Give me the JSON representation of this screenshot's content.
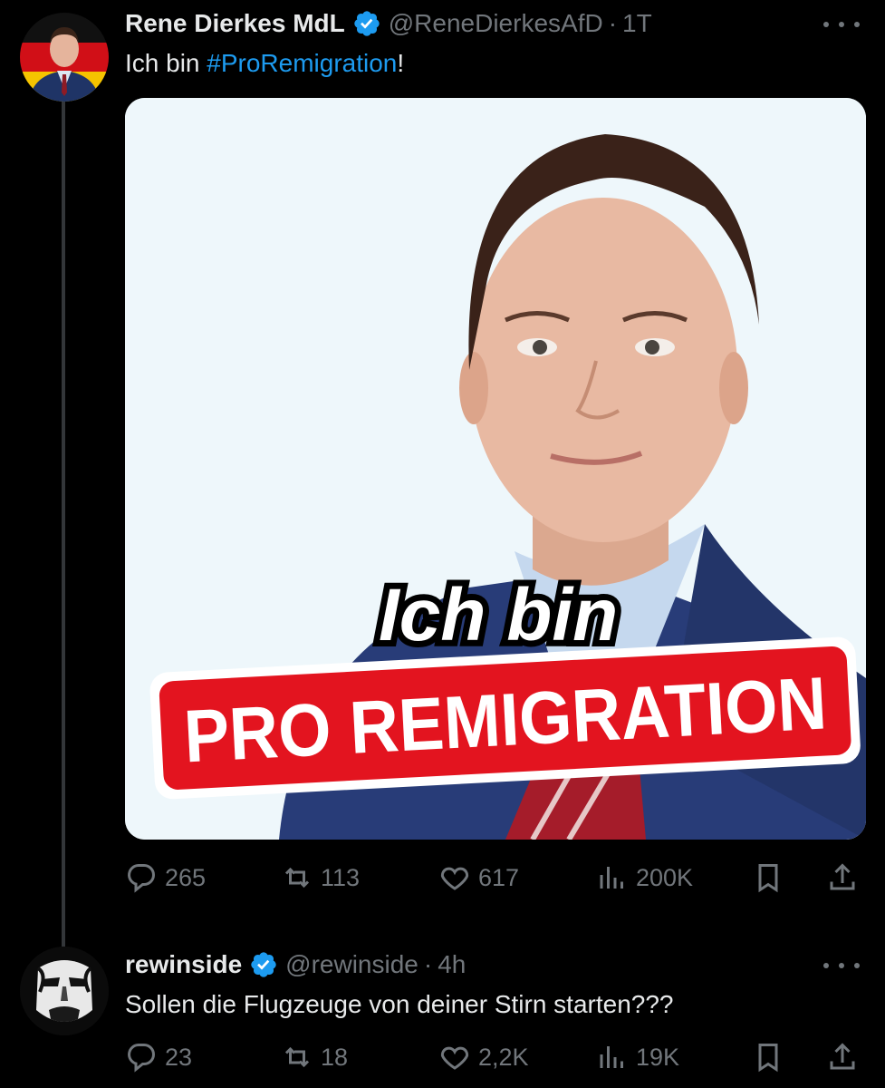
{
  "tweet": {
    "author_name": "Rene Dierkes MdL",
    "handle": "@ReneDierkesAfD",
    "separator": "·",
    "time": "1T",
    "text_prefix": "Ich bin ",
    "hashtag": "#ProRemigration",
    "text_suffix": "!",
    "image_text_line1": "Ich bin",
    "image_text_line2": "PRO REMIGRATION",
    "replies": "265",
    "reposts": "113",
    "likes": "617",
    "views": "200K"
  },
  "reply": {
    "author_name": "rewinside",
    "handle": "@rewinside",
    "separator": "·",
    "time": "4h",
    "text": "Sollen die Flugzeuge von deiner Stirn starten???",
    "replies": "23",
    "reposts": "18",
    "likes": "2,2K",
    "views": "19K"
  },
  "colors": {
    "background": "#000000",
    "text": "#e7e9ea",
    "muted": "#71767b",
    "link": "#1d9bf0",
    "verified": "#1d9bf0",
    "banner_red": "#e3141f"
  },
  "icons": [
    "verified-badge-icon",
    "more-icon",
    "reply-icon",
    "repost-icon",
    "like-icon",
    "views-icon",
    "bookmark-icon",
    "share-icon"
  ]
}
